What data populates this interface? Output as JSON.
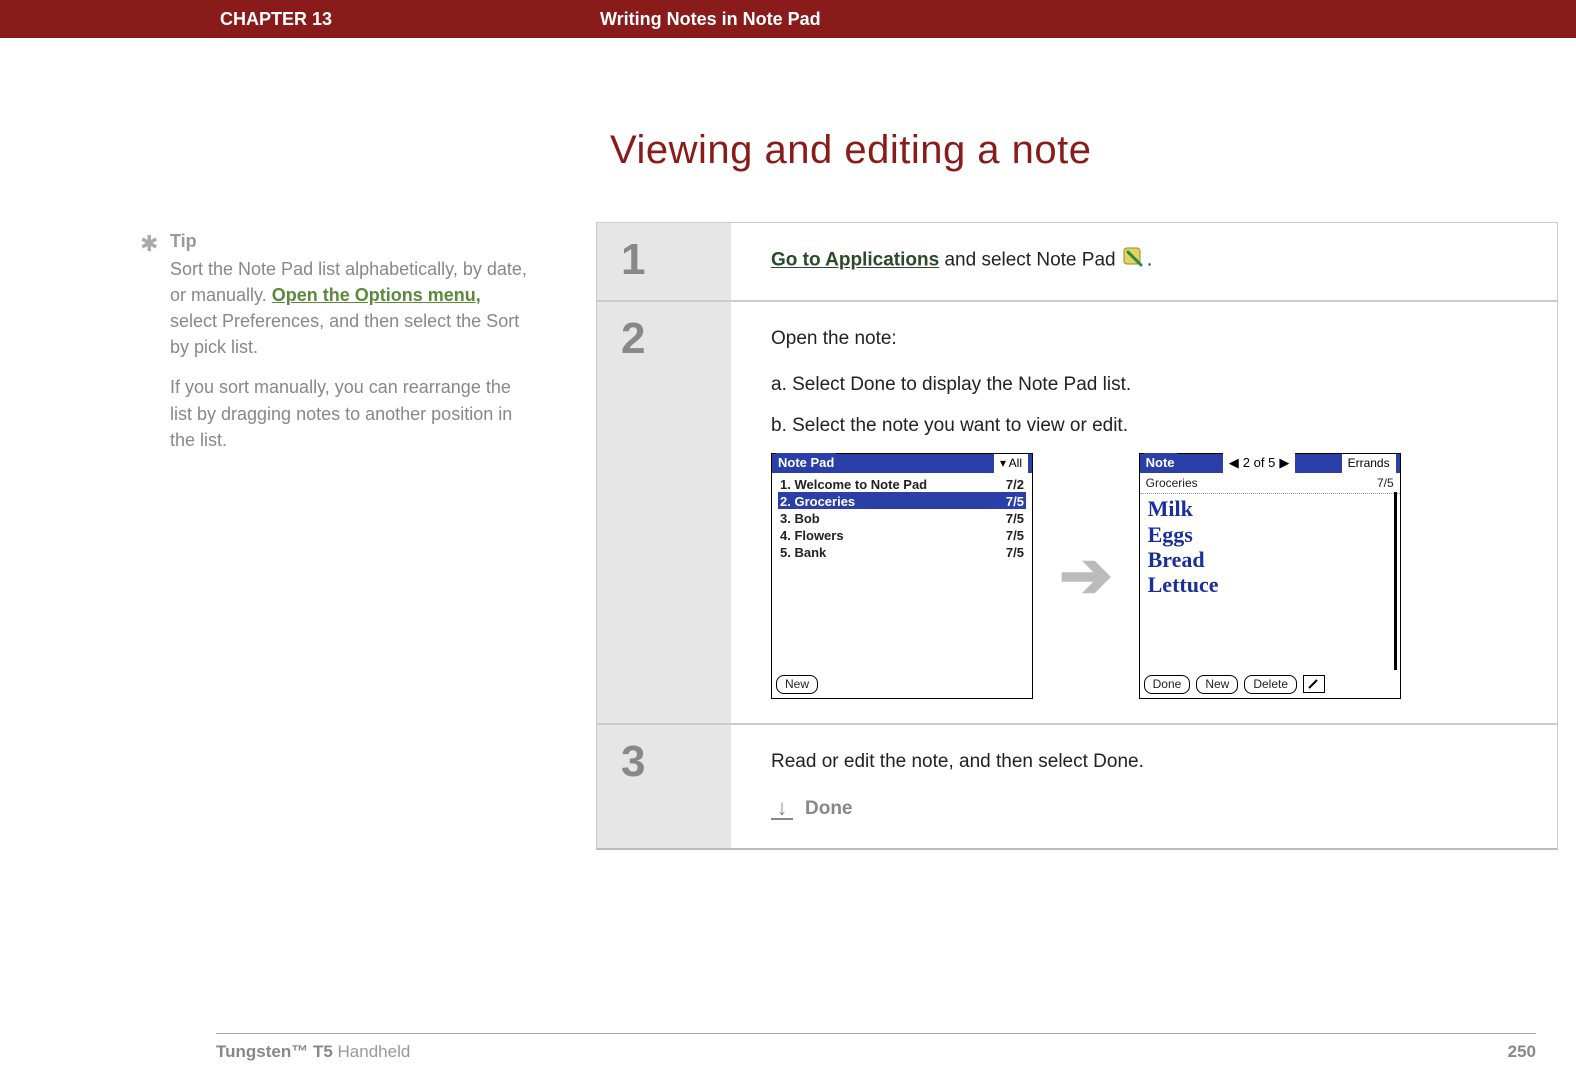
{
  "header": {
    "chapter": "CHAPTER 13",
    "title": "Writing Notes in Note Pad"
  },
  "heading": "Viewing and editing a note",
  "sidebar": {
    "tip_label": "Tip",
    "p1_a": "Sort the Note Pad list alphabetically, by date, or manually. ",
    "p1_link": "Open the Options menu,",
    "p1_b": " select Preferences, and then select the Sort by pick list.",
    "p2": "If you sort manually, you can rearrange the list by dragging notes to another position in the list."
  },
  "steps": {
    "s1": {
      "num": "1",
      "link": "Go to Applications",
      "rest": " and select Note Pad ",
      "period": "."
    },
    "s2": {
      "num": "2",
      "intro": "Open the note:",
      "a": "a.  Select Done to display the Note Pad list.",
      "b": "b.  Select the note you want to view or edit."
    },
    "s3": {
      "num": "3",
      "text": "Read or edit the note, and then select Done.",
      "done": "Done"
    }
  },
  "palm_list": {
    "title": "Note Pad",
    "category": "▾ All",
    "rows": [
      {
        "label": "1. Welcome to Note Pad",
        "date": "7/2",
        "sel": false
      },
      {
        "label": "2. Groceries",
        "date": "7/5",
        "sel": true
      },
      {
        "label": "3. Bob",
        "date": "7/5",
        "sel": false
      },
      {
        "label": "4. Flowers",
        "date": "7/5",
        "sel": false
      },
      {
        "label": "5. Bank",
        "date": "7/5",
        "sel": false
      }
    ],
    "new_btn": "New"
  },
  "palm_note": {
    "title": "Note",
    "pager": "2 of 5",
    "category": "Errands",
    "sub_left": "Groceries",
    "sub_right": "7/5",
    "lines": [
      "Milk",
      "Eggs",
      "Bread",
      "Lettuce"
    ],
    "done_btn": "Done",
    "new_btn": "New",
    "delete_btn": "Delete"
  },
  "footer": {
    "product_bold": "Tungsten™ T5",
    "product_rest": " Handheld",
    "page": "250"
  }
}
